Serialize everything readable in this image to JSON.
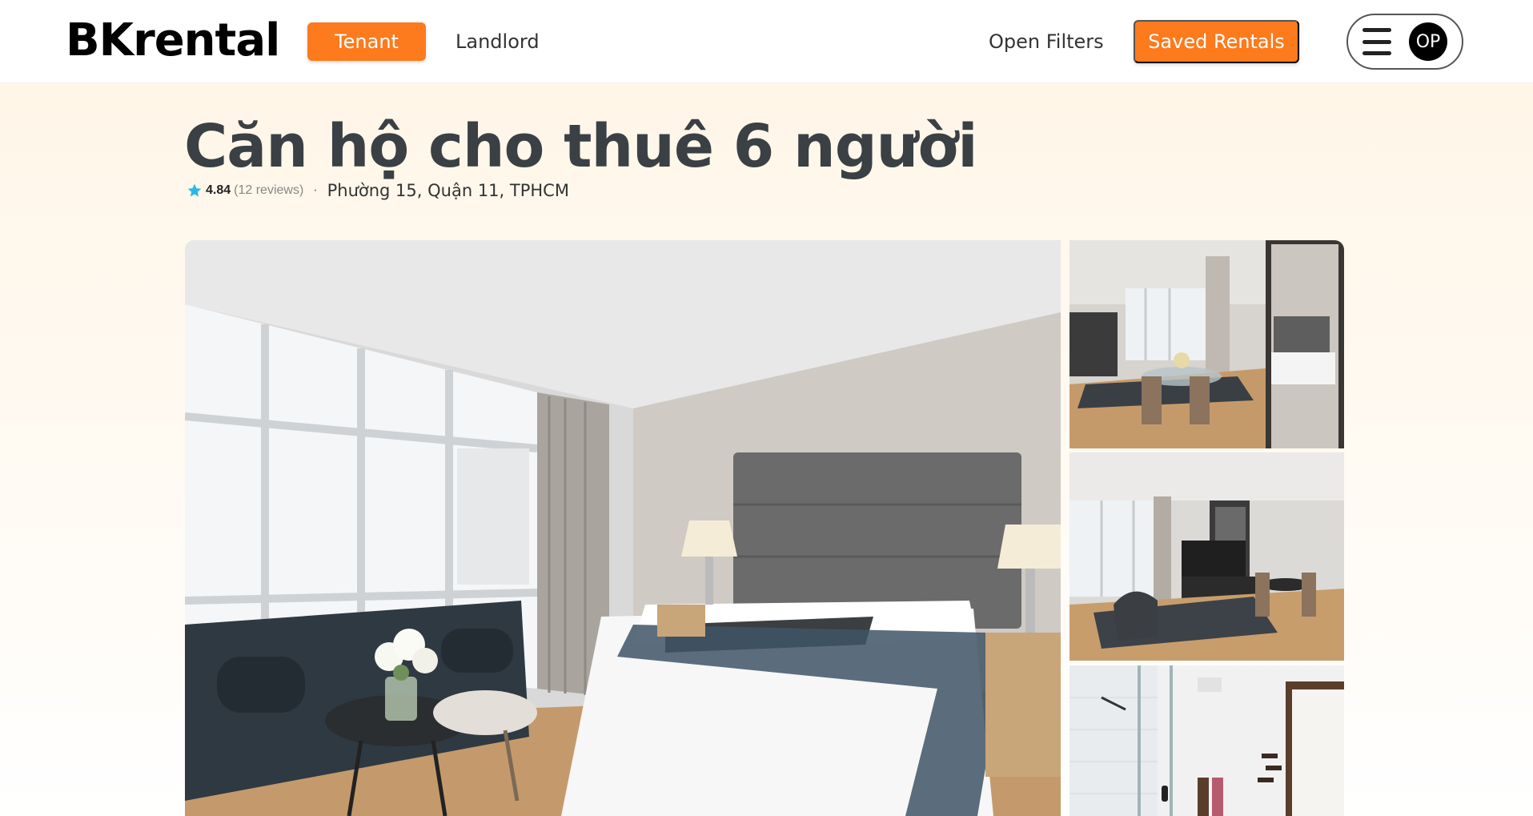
{
  "header": {
    "brand": "BKrental",
    "tenant_label": "Tenant",
    "landlord_label": "Landlord",
    "filters_label": "Open Filters",
    "saved_label": "Saved Rentals",
    "avatar_initials": "OP"
  },
  "listing": {
    "title": "Căn hộ cho thuê 6 người",
    "rating": "4.84",
    "reviews": "(12 reviews)",
    "separator": "·",
    "location": "Phường 15, Quận 11, TPHCM"
  },
  "colors": {
    "accent": "#fd7a1d",
    "star": "#2ab7e6",
    "title": "#3a4044"
  },
  "icons": {
    "menu": "hamburger-icon",
    "rating": "star-icon"
  }
}
